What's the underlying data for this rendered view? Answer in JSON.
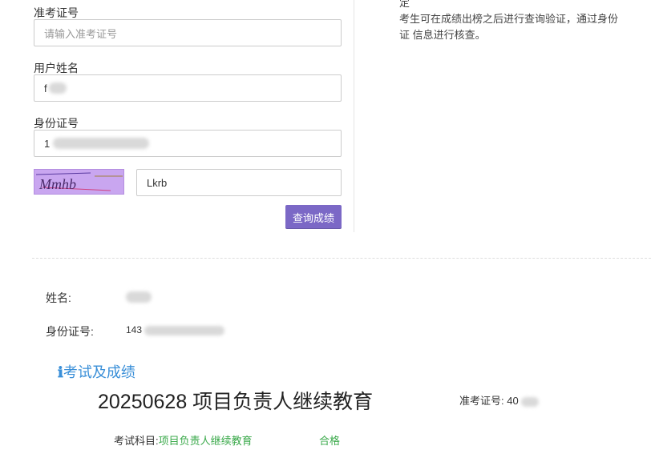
{
  "form": {
    "admission_label": "准考证号",
    "admission_placeholder": "请输入准考证号",
    "name_label": "用户姓名",
    "name_value": "f",
    "id_label": "身份证号",
    "id_value": "1",
    "captcha_value": "Lkrb",
    "captcha_image_text": "Mmhb",
    "submit_label": "查询成绩"
  },
  "note": {
    "line0": "定",
    "line1": "考生可在成绩出榜之后进行查询验证，通过身份",
    "line2": "证 信息进行核查。"
  },
  "result": {
    "name_label": "姓名:",
    "name_value": "",
    "id_label": "身份证号:",
    "id_value": "143",
    "section_title": "考试及成绩",
    "exam_title": "20250628 项目负责人继续教育",
    "admission_label": "准考证号:",
    "admission_value": "40",
    "subject_label": "考试科目:",
    "subject_value": "项目负责人继续教育",
    "status": "合格"
  },
  "colors": {
    "accent_button": "#7b68c6",
    "info_blue": "#3a8fd8",
    "pass_green": "#3aa94a",
    "captcha_bg": "#c9a6f0"
  }
}
